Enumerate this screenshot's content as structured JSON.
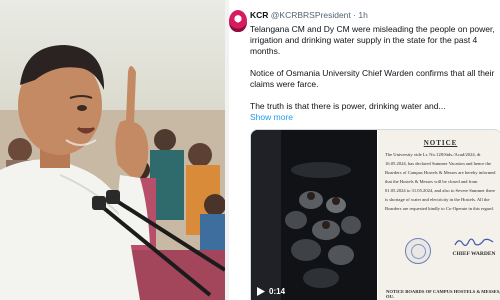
{
  "tweet": {
    "author_name": "KCR",
    "author_handle": "@KCRBRSPresident",
    "time_sep": "·",
    "time": "1h",
    "paragraphs": [
      "Telangana CM and Dy CM were misleading the people on power, irrigation and drinking water supply in the state for the past 4 months.",
      "Notice of Osmania University Chief Warden confirms that all their claims were farce.",
      "The truth is that there is power, drinking water and..."
    ],
    "show_more": "Show more"
  },
  "media": {
    "video_time": "0:14",
    "notice": {
      "title": "NOTICE",
      "body": "The University vide Lr. No.128/Stds./Acad/2024, dt 16.05.2024, has declared Summer Vacation and hence the Boarders of Campus Hostels & Messes are hereby informed that the Hostels & Messes will be closed and from 01.05.2024 to 31.05.2024, and also to Severe Summer there is shortage of water and electricity in the Hostels. All the Boarders are requested kindly to Co-Operate in this regard.",
      "signature": "Warden",
      "signer": "CHIEF WARDEN",
      "footer": "NOTICE BOARDS OF CAMPUS HOSTELS & MESSES, OU."
    }
  },
  "colors": {
    "link": "#1d9bf0",
    "secondary_text": "#536471",
    "primary_text": "#0f1419",
    "avatar": "#d81b60"
  },
  "icons": {
    "play": "play-icon",
    "avatar": "avatar"
  }
}
